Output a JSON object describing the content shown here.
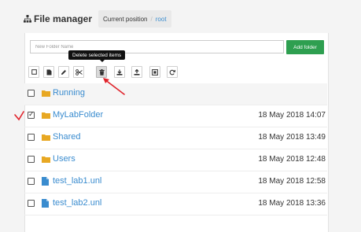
{
  "header": {
    "title": "File manager",
    "title_icon": "sitemap-icon",
    "breadcrumb": {
      "label": "Current position",
      "separator": "/",
      "path": "root"
    }
  },
  "new_folder": {
    "placeholder": "New Folder Name",
    "value": "",
    "button_label": "Add folder"
  },
  "toolbar": {
    "tooltip": "Delete selected items",
    "buttons": [
      {
        "name": "select-all",
        "icon": "square-icon"
      },
      {
        "name": "new-file",
        "icon": "file-icon"
      },
      {
        "name": "rename",
        "icon": "pencil-icon"
      },
      {
        "name": "cut",
        "icon": "scissors-icon"
      },
      {
        "name": "delete",
        "icon": "trash-icon",
        "active": true
      },
      {
        "name": "download",
        "icon": "download-icon"
      },
      {
        "name": "upload",
        "icon": "upload-icon"
      },
      {
        "name": "import",
        "icon": "import-icon"
      },
      {
        "name": "refresh",
        "icon": "refresh-icon"
      }
    ]
  },
  "files": [
    {
      "name": "Running",
      "type": "folder",
      "date": "",
      "checked": false
    },
    {
      "name": "MyLabFolder",
      "type": "folder",
      "date": "18 May 2018 14:07",
      "checked": true
    },
    {
      "name": "Shared",
      "type": "folder",
      "date": "18 May 2018 13:49",
      "checked": false
    },
    {
      "name": "Users",
      "type": "folder",
      "date": "18 May 2018 12:48",
      "checked": false
    },
    {
      "name": "test_lab1.unl",
      "type": "file",
      "date": "18 May 2018 12:58",
      "checked": false
    },
    {
      "name": "test_lab2.unl",
      "type": "file",
      "date": "18 May 2018 13:36",
      "checked": false
    }
  ],
  "colors": {
    "accent_link": "#3a8ccf",
    "folder": "#e8a823",
    "add_button": "#2e9f50",
    "annotation": "#e0232b"
  }
}
